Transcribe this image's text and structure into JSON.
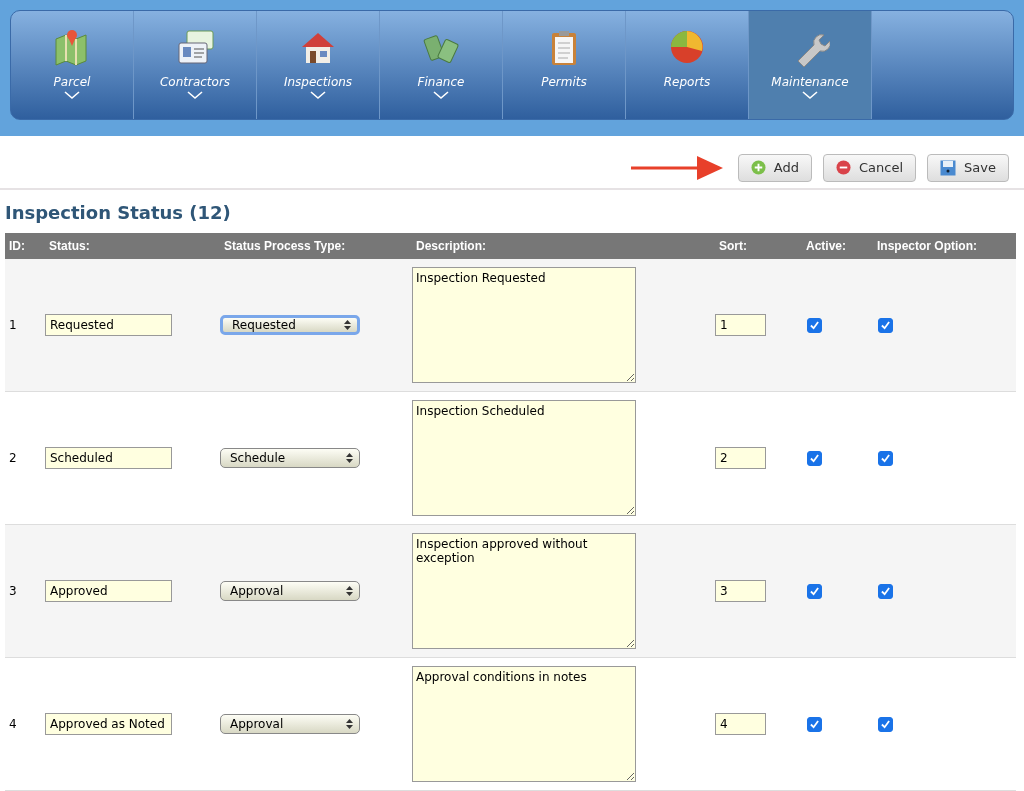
{
  "nav": [
    {
      "label": "Parcel",
      "has_menu": true,
      "selected": false
    },
    {
      "label": "Contractors",
      "has_menu": true,
      "selected": false
    },
    {
      "label": "Inspections",
      "has_menu": true,
      "selected": false
    },
    {
      "label": "Finance",
      "has_menu": true,
      "selected": false
    },
    {
      "label": "Permits",
      "has_menu": false,
      "selected": false
    },
    {
      "label": "Reports",
      "has_menu": false,
      "selected": false
    },
    {
      "label": "Maintenance",
      "has_menu": true,
      "selected": true
    }
  ],
  "toolbar": [
    {
      "label": "Add",
      "kind": "add",
      "highlighted": true
    },
    {
      "label": "Cancel",
      "kind": "cancel",
      "highlighted": false
    },
    {
      "label": "Save",
      "kind": "save",
      "highlighted": false
    }
  ],
  "title": "Inspection Status (12)",
  "columns": [
    "ID:",
    "Status:",
    "Status Process Type:",
    "Description:",
    "Sort:",
    "Active:",
    "Inspector Option:"
  ],
  "rows": [
    {
      "id": "1",
      "status": "Requested",
      "process_type": "Requested",
      "focused": true,
      "description": "Inspection Requested",
      "sort": "1",
      "active": true,
      "inspector_option": true
    },
    {
      "id": "2",
      "status": "Scheduled",
      "process_type": "Schedule",
      "focused": false,
      "description": "Inspection Scheduled",
      "sort": "2",
      "active": true,
      "inspector_option": true
    },
    {
      "id": "3",
      "status": "Approved",
      "process_type": "Approval",
      "focused": false,
      "description": "Inspection approved without exception",
      "sort": "3",
      "active": true,
      "inspector_option": true
    },
    {
      "id": "4",
      "status": "Approved as Noted",
      "process_type": "Approval",
      "focused": false,
      "description": "Approval conditions in notes",
      "sort": "4",
      "active": true,
      "inspector_option": true
    }
  ]
}
